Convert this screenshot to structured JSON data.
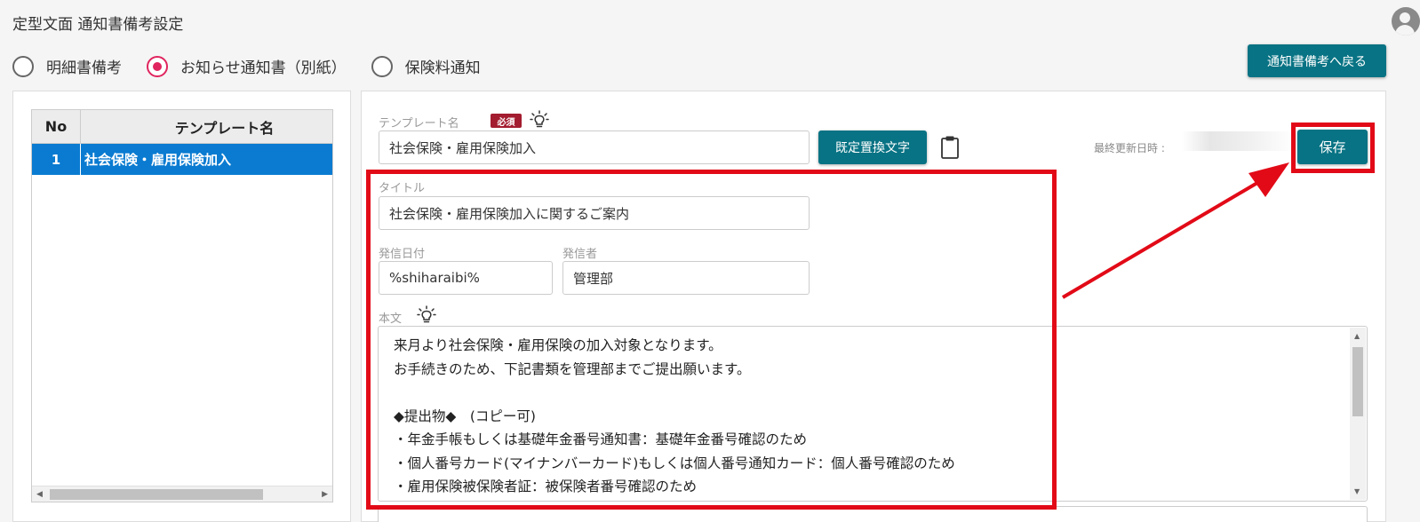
{
  "header": {
    "title": "定型文面 通知書備考設定",
    "back_button": "通知書備考へ戻る"
  },
  "document_type": {
    "options": [
      "明細書備考",
      "お知らせ通知書（別紙）",
      "保険料通知"
    ],
    "selected_index": 1
  },
  "template_list": {
    "columns": [
      "No",
      "テンプレート名"
    ],
    "rows": [
      {
        "no": "1",
        "name": "社会保険・雇用保険加入"
      }
    ]
  },
  "form": {
    "template_name_label": "テンプレート名",
    "required_badge": "必須",
    "template_name_value": "社会保険・雇用保険加入",
    "replace_button": "既定置換文字",
    "last_updated_label": "最終更新日時 :",
    "save_button": "保存",
    "title_label": "タイトル",
    "title_value": "社会保険・雇用保険加入に関するご案内",
    "issue_date_label": "発信日付",
    "issue_date_value": "%shiharaibi%",
    "sender_label": "発信者",
    "sender_value": "管理部",
    "body_label": "本文",
    "body_value": "来月より社会保険・雇用保険の加入対象となります。\nお手続きのため、下記書類を管理部までご提出願います。\n\n◆提出物◆　(コピー可)\n・年金手帳もしくは基礎年金番号通知書：基礎年金番号確認のため\n・個人番号カード(マイナンバーカード)もしくは個人番号通知カード：個人番号確認のため\n・雇用保険被保険者証：被保険者番号確認のため"
  },
  "annotation_color": "#e20a17",
  "accent_color": "#087384",
  "selection_color": "#0a7bd1",
  "radio_color": "#e0245e"
}
